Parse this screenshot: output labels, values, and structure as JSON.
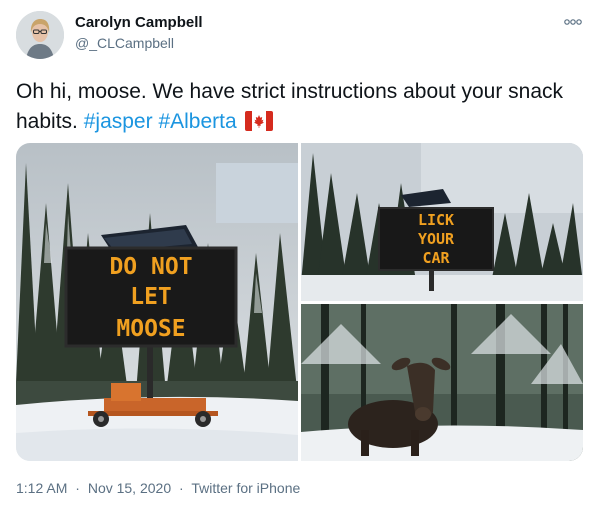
{
  "author": {
    "name": "Carolyn Campbell",
    "handle": "@_CLCampbell"
  },
  "more_icon": "more-horizontal-icon",
  "tweet": {
    "text": "Oh hi, moose. We have strict instructions about your snack habits. ",
    "hashtags": [
      "#jasper",
      "#Alberta"
    ],
    "flag_icon": "canada-flag-icon"
  },
  "media": {
    "left": {
      "sign_lines": [
        "DO NOT",
        "LET",
        "MOOSE"
      ]
    },
    "top_right": {
      "sign_lines": [
        "LICK",
        "YOUR",
        "CAR"
      ]
    },
    "bottom_right": {}
  },
  "meta": {
    "time": "1:12 AM",
    "date": "Nov 15, 2020",
    "separator": "·",
    "source": "Twitter for iPhone"
  },
  "colors": {
    "hashtag": "#1b95e0",
    "secondary_text": "#5b7083",
    "sign_text": "#f0a020"
  }
}
